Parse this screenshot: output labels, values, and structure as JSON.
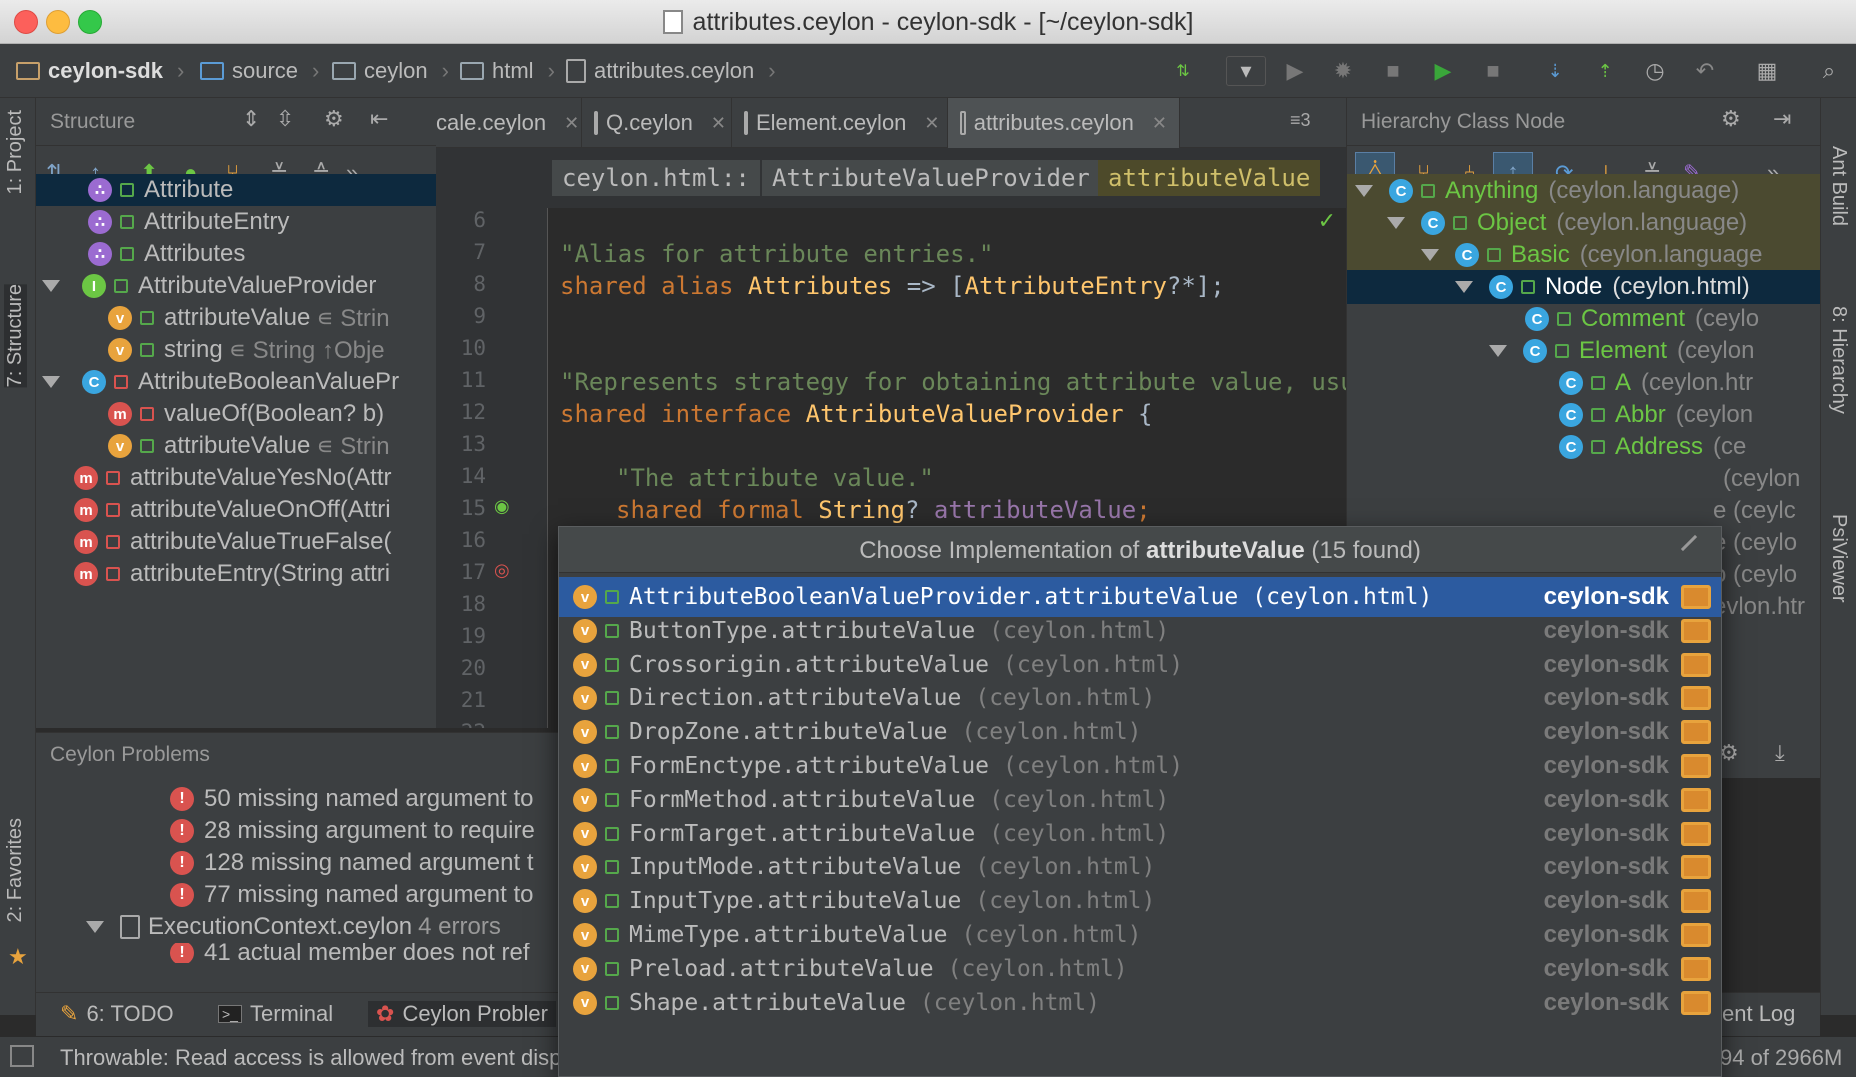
{
  "window": {
    "title": "attributes.ceylon - ceylon-sdk - [~/ceylon-sdk]"
  },
  "breadcrumbs": [
    "ceylon-sdk",
    "source",
    "ceylon",
    "html",
    "attributes.ceylon"
  ],
  "left_stripe": {
    "project": "1: Project",
    "structure": "7: Structure",
    "favorites": "2: Favorites"
  },
  "right_stripe": {
    "ant": "Ant Build",
    "hierarchy": "8: Hierarchy",
    "psi": "PsiViewer"
  },
  "structure": {
    "title": "Structure",
    "items": [
      {
        "label": "Attribute",
        "badge": "cls"
      },
      {
        "label": "AttributeEntry",
        "badge": "cls"
      },
      {
        "label": "Attributes",
        "badge": "cls"
      },
      {
        "label": "AttributeValueProvider",
        "badge": "I"
      },
      {
        "label": "attributeValue",
        "sub": "∊ Strin",
        "badge": "v"
      },
      {
        "label": "string",
        "sub": "∊ String ↑Obje",
        "badge": "v"
      },
      {
        "label": "AttributeBooleanValuePr",
        "badge": "C"
      },
      {
        "label": "valueOf(Boolean? b)",
        "badge": "m"
      },
      {
        "label": "attributeValue",
        "sub": "∊ Strin",
        "badge": "v"
      },
      {
        "label": "attributeValueYesNo(Attr",
        "badge": "m"
      },
      {
        "label": "attributeValueOnOff(Attri",
        "badge": "m"
      },
      {
        "label": "attributeValueTrueFalse(",
        "badge": "m"
      },
      {
        "label": "attributeEntry(String attri",
        "badge": "m"
      }
    ]
  },
  "problems": {
    "title": "Ceylon Problems",
    "rows": [
      "50 missing named argument to",
      "28 missing argument to require",
      "128 missing named argument t",
      "77 missing named argument to"
    ],
    "file": {
      "name": "ExecutionContext.ceylon",
      "count": "4 errors"
    },
    "partial": "41 actual member does not ref"
  },
  "editor": {
    "tabs": [
      "cale.ceylon",
      "Q.ceylon",
      "Element.ceylon",
      "attributes.ceylon"
    ],
    "overflow": "≡3",
    "crumbs": [
      "ceylon.html::",
      "AttributeValueProvider",
      "attributeValue"
    ],
    "line_numbers": [
      "6",
      "7",
      "8",
      "9",
      "10",
      "11",
      "12",
      "13",
      "14",
      "15",
      "16",
      "17",
      "18",
      "19",
      "20",
      "21",
      "22"
    ],
    "lines": {
      "l7": "\"Alias for attribute entries.\"",
      "l8_a": "shared ",
      "l8_b": "alias ",
      "l8_c": "Attributes",
      "l8_d": " => [",
      "l8_e": "AttributeEntry",
      "l8_f": "?*];",
      "l11": "\"Represents strategy for obtaining attribute value, usua",
      "l12_a": "shared ",
      "l12_b": "interface ",
      "l12_c": "AttributeValueProvider",
      "l12_d": " {",
      "l14": "\"The attribute value.\"",
      "l15_a": "shared formal ",
      "l15_b": "String",
      "l15_c": "? ",
      "l15_d": "attributeValue",
      "l15_e": ";"
    }
  },
  "hierarchy": {
    "title": "Hierarchy Class Node",
    "rows": [
      {
        "name": "Anything",
        "pkg": "(ceylon.language)"
      },
      {
        "name": "Object",
        "pkg": "(ceylon.language)"
      },
      {
        "name": "Basic",
        "pkg": "(ceylon.language"
      },
      {
        "name": "Node",
        "pkg": "(ceylon.html)"
      },
      {
        "name": "Comment",
        "pkg": "(ceylo"
      },
      {
        "name": "Element",
        "pkg": "(ceylon"
      },
      {
        "name": "A",
        "pkg": "(ceylon.htr"
      },
      {
        "name": "Abbr",
        "pkg": "(ceylon"
      },
      {
        "name": "Address",
        "pkg": "(ce"
      }
    ],
    "peek": [
      "(ceylon",
      "e (ceylc",
      "e (ceylo",
      "o (ceylo",
      "evlon.htr"
    ]
  },
  "popup": {
    "title_prefix": "Choose Implementation of ",
    "title_bold": "attributeValue",
    "title_suffix": " (15 found)",
    "items": [
      {
        "name": "AttributeBooleanValueProvider.attributeValue",
        "pkg": "(ceylon.html)",
        "module": "ceylon-sdk"
      },
      {
        "name": "ButtonType.attributeValue",
        "pkg": "(ceylon.html)",
        "module": "ceylon-sdk"
      },
      {
        "name": "Crossorigin.attributeValue",
        "pkg": "(ceylon.html)",
        "module": "ceylon-sdk"
      },
      {
        "name": "Direction.attributeValue",
        "pkg": "(ceylon.html)",
        "module": "ceylon-sdk"
      },
      {
        "name": "DropZone.attributeValue",
        "pkg": "(ceylon.html)",
        "module": "ceylon-sdk"
      },
      {
        "name": "FormEnctype.attributeValue",
        "pkg": "(ceylon.html)",
        "module": "ceylon-sdk"
      },
      {
        "name": "FormMethod.attributeValue",
        "pkg": "(ceylon.html)",
        "module": "ceylon-sdk"
      },
      {
        "name": "FormTarget.attributeValue",
        "pkg": "(ceylon.html)",
        "module": "ceylon-sdk"
      },
      {
        "name": "InputMode.attributeValue",
        "pkg": "(ceylon.html)",
        "module": "ceylon-sdk"
      },
      {
        "name": "InputType.attributeValue",
        "pkg": "(ceylon.html)",
        "module": "ceylon-sdk"
      },
      {
        "name": "MimeType.attributeValue",
        "pkg": "(ceylon.html)",
        "module": "ceylon-sdk"
      },
      {
        "name": "Preload.attributeValue",
        "pkg": "(ceylon.html)",
        "module": "ceylon-sdk"
      },
      {
        "name": "Shape.attributeValue",
        "pkg": "(ceylon.html)",
        "module": "ceylon-sdk"
      }
    ]
  },
  "bottom_tools": {
    "todo": "6: TODO",
    "terminal": "Terminal",
    "problems": "Ceylon Probler",
    "event_log": "ent Log"
  },
  "status": {
    "message": "Throwable: Read access is allowed from event disp",
    "memory": "94 of 2966M"
  },
  "colors": {
    "selection": "#2c5ba0",
    "tree_selection": "#0d293e",
    "accent_green": "#6cc644",
    "badge_orange": "#e8a33d"
  }
}
